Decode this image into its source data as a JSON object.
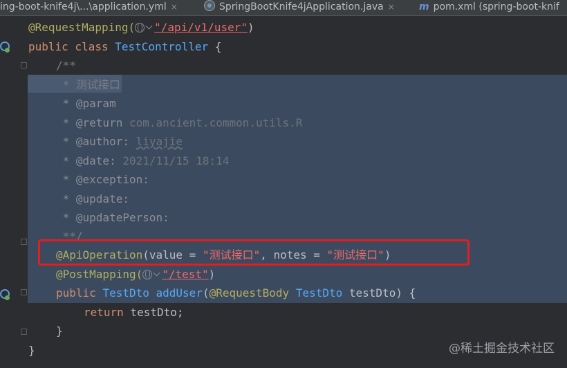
{
  "tabs": [
    {
      "label": "ing-boot-knife4j\\...\\application.yml",
      "close": "×"
    },
    {
      "label": "SpringBootKnife4jApplication.java",
      "close": "×"
    },
    {
      "label": "pom.xml (spring-boot-knif"
    }
  ],
  "code": {
    "l1": {
      "ann": "@RequestMapping(",
      "str": "\"/api/v1/user\"",
      "end": ")"
    },
    "l2": {
      "kw": "public class ",
      "cls": "TestController",
      "rest": " {"
    },
    "l3": "/**",
    "l4": " * 测试接口",
    "l5": " * @param",
    "l6": {
      "tag": " * @return ",
      "ref": "com.ancient.common.utils.R"
    },
    "l7": {
      "tag": " * @author: ",
      "ref": "liyajie"
    },
    "l8": {
      "tag": " * @date: ",
      "ref": "2021/11/15 18:14"
    },
    "l9": " * @exception:",
    "l10": " * @update:",
    "l11": " * @updatePerson:",
    "l12": " **/",
    "l13": {
      "ann": "@ApiOperation",
      "p1": "(value = ",
      "s1": "\"测试接口\"",
      "p2": ", notes = ",
      "s2": "\"测试接口\"",
      "end": ")"
    },
    "l14": {
      "ann": "@PostMapping(",
      "str": "\"/test\"",
      "end": ")"
    },
    "l15": {
      "kw": "public ",
      "cls": "TestDto",
      "sp": " ",
      "method": "addUser",
      "p": "(",
      "ann": "@RequestBody ",
      "cls2": "TestDto",
      "rest": " testDto) {"
    },
    "l16": {
      "kw": "return",
      "rest": " testDto;"
    },
    "l17": "}",
    "l18": "}"
  },
  "watermark": "@稀土掘金技术社区"
}
